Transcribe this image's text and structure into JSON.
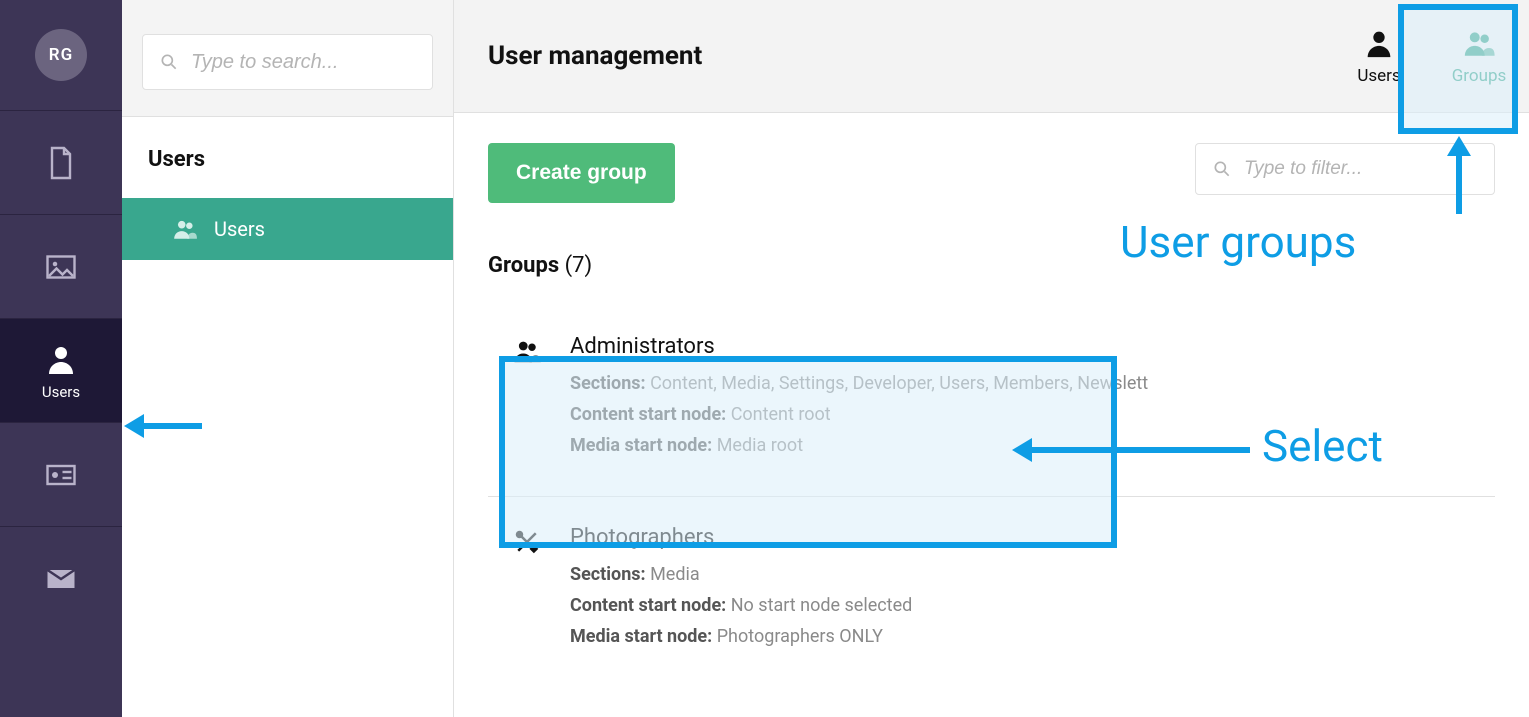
{
  "avatar": {
    "initials": "RG"
  },
  "rail": {
    "users_label": "Users"
  },
  "tree": {
    "search_placeholder": "Type to search...",
    "heading": "Users",
    "item_label": "Users"
  },
  "header": {
    "title": "User management",
    "tab_users": "Users",
    "tab_groups": "Groups"
  },
  "actions": {
    "create_label": "Create group",
    "filter_placeholder": "Type to filter..."
  },
  "groups_heading": {
    "label": "Groups",
    "count": "(7)"
  },
  "groups": [
    {
      "name": "Administrators",
      "sections_label": "Sections:",
      "sections_value": "Content, Media, Settings, Developer, Users, Members, Newslett",
      "content_label": "Content start node:",
      "content_value": "Content root",
      "media_label": "Media start node:",
      "media_value": "Media root",
      "icon": "group"
    },
    {
      "name": "Photographers",
      "sections_label": "Sections:",
      "sections_value": "Media",
      "content_label": "Content start node:",
      "content_value": "No start node selected",
      "media_label": "Media start node:",
      "media_value": "Photographers ONLY",
      "icon": "wrench"
    }
  ],
  "annotations": {
    "users_arrow": "",
    "groups_label": "User groups",
    "select_label": "Select"
  }
}
